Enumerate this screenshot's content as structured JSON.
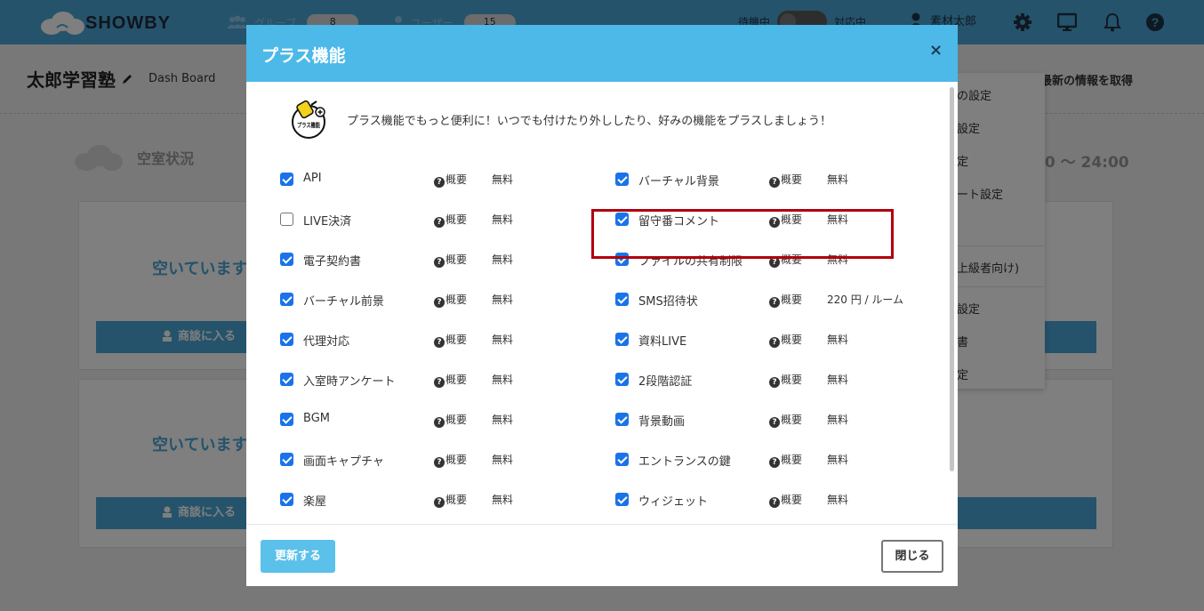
{
  "app": {
    "brand": "SHOWBY"
  },
  "topbar": {
    "group_label": "グループ",
    "group_count": "8",
    "user_label": "ユーザー",
    "user_count": "15",
    "status_off": "待機中",
    "status_on": "対応中",
    "account_name": "素材太郎"
  },
  "page": {
    "title": "太郎学習塾",
    "breadcrumb": "Dash Board",
    "refresh_label": "最新の情報を取得",
    "section_title": "空室状況",
    "hours": "00 〜 24:00",
    "rooms": [
      {
        "status": "空いています",
        "button": "商談に入る"
      },
      {
        "status": "空いています",
        "button": "商談に入る"
      }
    ]
  },
  "side_menu": {
    "items": [
      "の設定",
      "設定",
      "定",
      "ート設定",
      "上級者向け)",
      "設定",
      "書",
      "定"
    ]
  },
  "modal": {
    "title": "プラス機能",
    "close_symbol": "×",
    "icon_text": "プラス機能",
    "intro": "プラス機能でもっと便利に！いつでも付けたり外ししたり、好みの機能をプラスしましょう！",
    "summary_label": "概要",
    "left_features": [
      {
        "name": "API",
        "price": "無料",
        "checked": true
      },
      {
        "name": "LIVE決済",
        "price": "無料",
        "checked": false
      },
      {
        "name": "電子契約書",
        "price": "無料",
        "checked": true
      },
      {
        "name": "バーチャル前景",
        "price": "無料",
        "checked": true
      },
      {
        "name": "代理対応",
        "price": "無料",
        "checked": true
      },
      {
        "name": "入室時アンケート",
        "price": "無料",
        "checked": true
      },
      {
        "name": "BGM",
        "price": "無料",
        "checked": true
      },
      {
        "name": "画面キャプチャ",
        "price": "無料",
        "checked": true
      },
      {
        "name": "楽屋",
        "price": "無料",
        "checked": true
      }
    ],
    "right_features": [
      {
        "name": "バーチャル背景",
        "price": "無料",
        "checked": true
      },
      {
        "name": "留守番コメント",
        "price": "無料",
        "checked": true
      },
      {
        "name": "ファイルの共有制限",
        "price": "無料",
        "checked": true
      },
      {
        "name": "SMS招待状",
        "price": "220 円 / ルーム",
        "checked": true
      },
      {
        "name": "資料LIVE",
        "price": "無料",
        "checked": true
      },
      {
        "name": "2段階認証",
        "price": "無料",
        "checked": true
      },
      {
        "name": "背景動画",
        "price": "無料",
        "checked": true
      },
      {
        "name": "エントランスの鍵",
        "price": "無料",
        "checked": true
      },
      {
        "name": "ウィジェット",
        "price": "無料",
        "checked": true
      }
    ],
    "update_button": "更新する",
    "close_button": "閉じる"
  },
  "colors": {
    "header_blue": "#4ba6d6",
    "modal_header": "#4cb9e8",
    "checkbox_blue": "#1a73e8",
    "highlight_red": "#b0000c"
  }
}
